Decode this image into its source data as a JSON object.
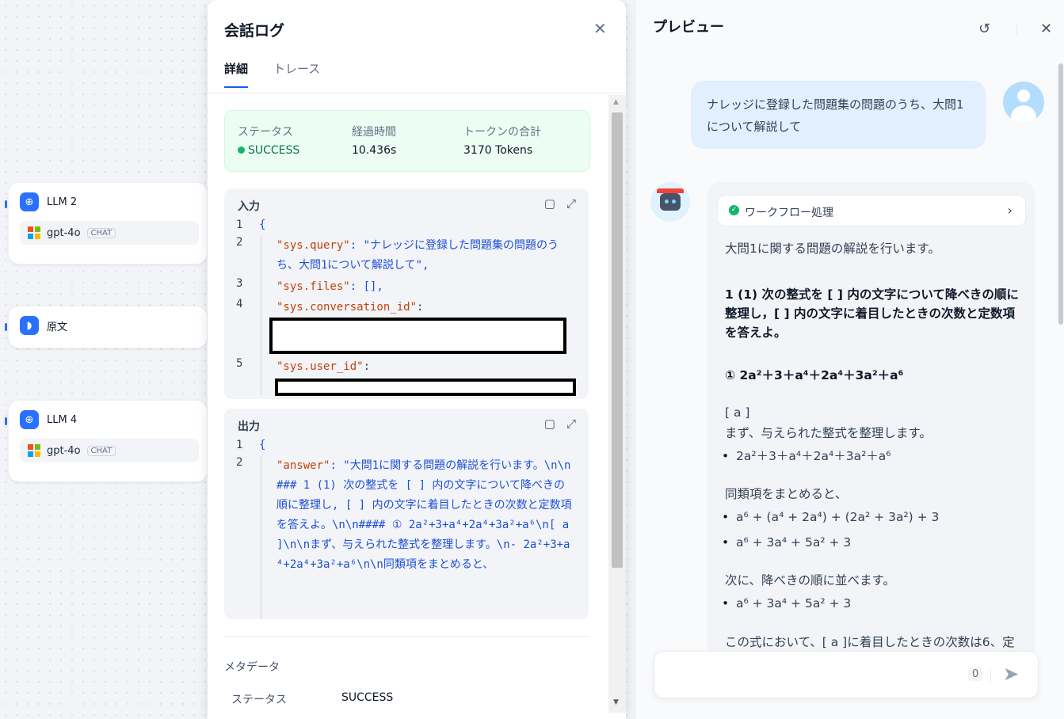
{
  "canvas": {
    "nodes": [
      {
        "title": "LLM 2",
        "model": "gpt-4o",
        "tag": "CHAT"
      },
      {
        "title": "原文"
      },
      {
        "title": "LLM 4",
        "model": "gpt-4o",
        "tag": "CHAT"
      }
    ]
  },
  "log": {
    "title": "会話ログ",
    "tabs": [
      "詳細",
      "トレース"
    ],
    "status": {
      "status_label": "ステータス",
      "status_value": "SUCCESS",
      "elapsed_label": "経過時間",
      "elapsed_value": "10.436s",
      "tokens_label": "トークンの合計",
      "tokens_value": "3170 Tokens"
    },
    "input": {
      "title": "入力",
      "lines": [
        {
          "n": "1",
          "text": "{"
        },
        {
          "n": "2",
          "key": "\"sys.query\"",
          "value": ": \"ナレッジに登録した問題集の問題のうち、大問1について解説して\","
        },
        {
          "n": "3",
          "key": "\"sys.files\"",
          "value": ": [],"
        },
        {
          "n": "4",
          "key": "\"sys.conversation_id\"",
          "value": ":"
        },
        {
          "n": "5",
          "key": "\"sys.user_id\"",
          "value": ":"
        }
      ]
    },
    "output": {
      "title": "出力",
      "lines": [
        {
          "n": "1",
          "text": "{"
        },
        {
          "n": "2",
          "key": "\"answer\"",
          "value": ": \"大問1に関する問題の解説を行います。\\n\\n### 1 (1) 次の整式を [ ] 内の文字について降べきの順に整理し, [ ] 内の文字に着目したときの次数と定数項を答えよ。\\n\\n#### ① 2a²+3+a⁴+2a⁴+3a²+a⁶\\n[ a ]\\n\\nまず、与えられた整式を整理します。\\n- 2a²+3+a⁴+2a⁴+3a²+a⁶\\n\\n同類項をまとめると、"
        }
      ]
    },
    "metadata": {
      "title": "メタデータ",
      "status_label": "ステータス",
      "status_value": "SUCCESS"
    }
  },
  "preview": {
    "title": "プレビュー",
    "user_message": "ナレッジに登録した問題集の問題のうち、大問1について解説して",
    "workflow_label": "ワークフロー処理",
    "answer": {
      "intro": "大問1に関する問題の解説を行います。",
      "heading": "1 (1) 次の整式を [ ] 内の文字について降べきの順に整理し，[ ] 内の文字に着目したときの次数と定数項を答えよ。",
      "expr": "① 2a²＋3＋a⁴＋2a⁴＋3a²＋a⁶",
      "var": "[ a ]",
      "step1": "まず、与えられた整式を整理します。",
      "bullet1": "2a²＋3＋a⁴＋2a⁴＋3a²＋a⁶",
      "step2": "同類項をまとめると、",
      "bullet2a": "a⁶ + (a⁴ + 2a⁴) + (2a² + 3a²) + 3",
      "bullet2b": "a⁶ + 3a⁴ + 5a² + 3",
      "step3": "次に、降べきの順に並べます。",
      "bullet3": "a⁶ + 3a⁴ + 5a² + 3",
      "step4": "この式において、[ a ]に着目したときの次数は6、定"
    },
    "input_counter": "0"
  }
}
